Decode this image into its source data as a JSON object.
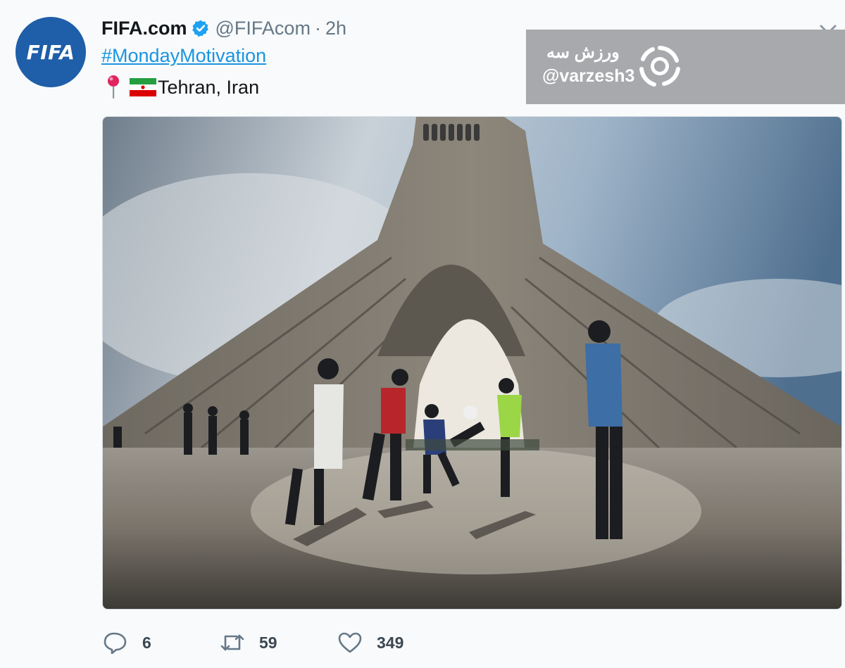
{
  "tweet": {
    "avatar_text": "FIFA",
    "display_name": "FIFA.com",
    "handle": "@FIFAcom",
    "separator": "·",
    "time": "2h",
    "hashtag_symbol": "#",
    "hashtag": "MondayMotivation",
    "location_text": "Tehran, Iran",
    "icons": [
      "verified-badge-icon",
      "chevron-down-icon",
      "location-pin-icon",
      "iran-flag-icon"
    ]
  },
  "watermark": {
    "name_fa": "ورزش سه",
    "handle": "@varzesh3",
    "logo": "varzesh3-logo-icon"
  },
  "photo": {
    "description_icon": "photo"
  },
  "actions": {
    "reply_count": "6",
    "retweet_count": "59",
    "like_count": "349",
    "icons": [
      "reply-icon",
      "retweet-icon",
      "like-icon"
    ]
  },
  "colors": {
    "link": "#1b95e0",
    "verified": "#1da1f2",
    "avatar_bg": "#1f5ea8",
    "muted": "#657786"
  }
}
